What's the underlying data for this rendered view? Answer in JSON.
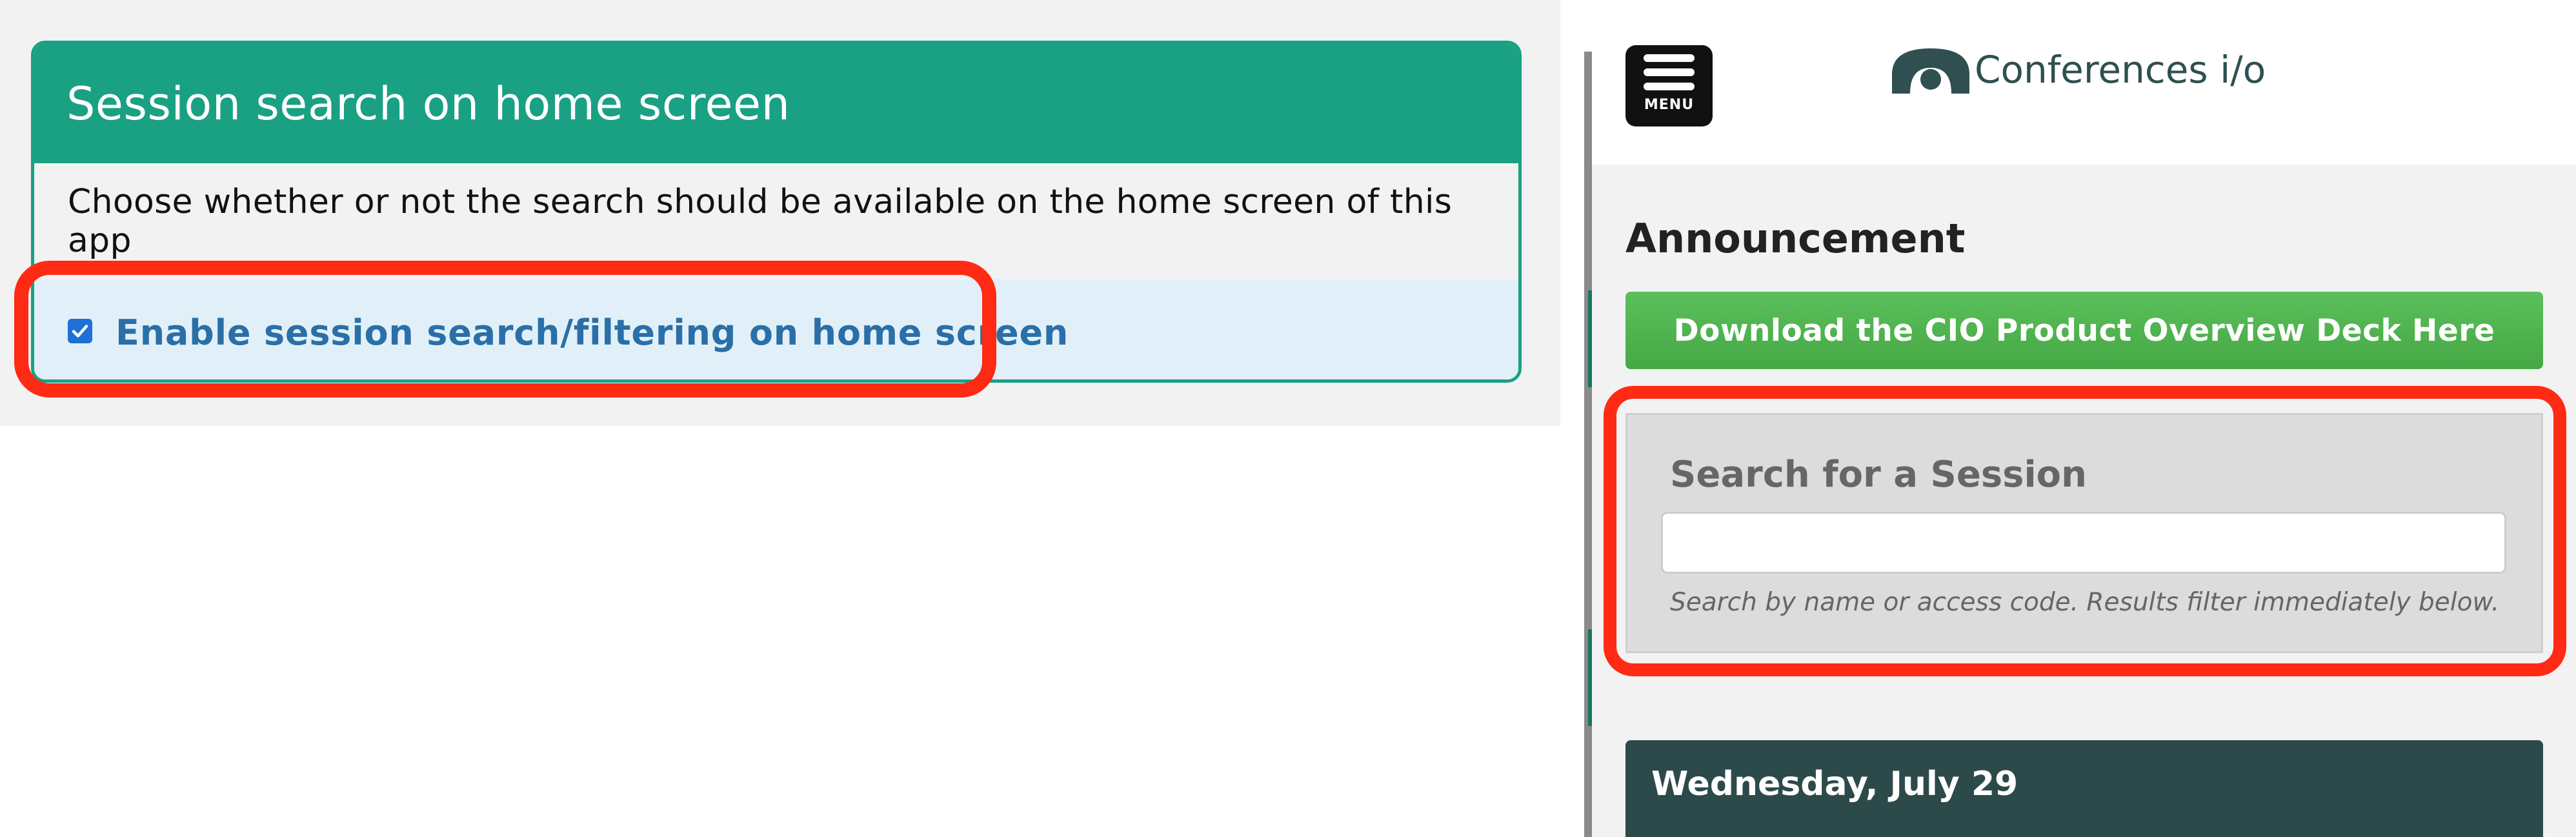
{
  "settings": {
    "header": "Session search on home screen",
    "description": "Choose whether or not the search should be available on the home screen of this app",
    "option_label": "Enable session search/filtering on home screen",
    "option_checked": true
  },
  "phone": {
    "menu_label": "MENU",
    "brand": "Conferences i/o",
    "announcement_title": "Announcement",
    "download_button": "Download the CIO Product Overview Deck Here",
    "search": {
      "title": "Search for a Session",
      "input_value": "",
      "help_text": "Search by name or access code. Results filter immediately below."
    },
    "day_header": "Wednesday, July 29"
  },
  "colors": {
    "header_teal": "#1aa083",
    "highlight_red": "#ff2a14",
    "option_bg": "#e1f0f8",
    "download_green": "#4cb14c",
    "day_header_dark": "#2d4a4b"
  },
  "icons": [
    "checkbox-checked-icon",
    "hamburger-menu-icon",
    "conferences-logo-icon"
  ]
}
